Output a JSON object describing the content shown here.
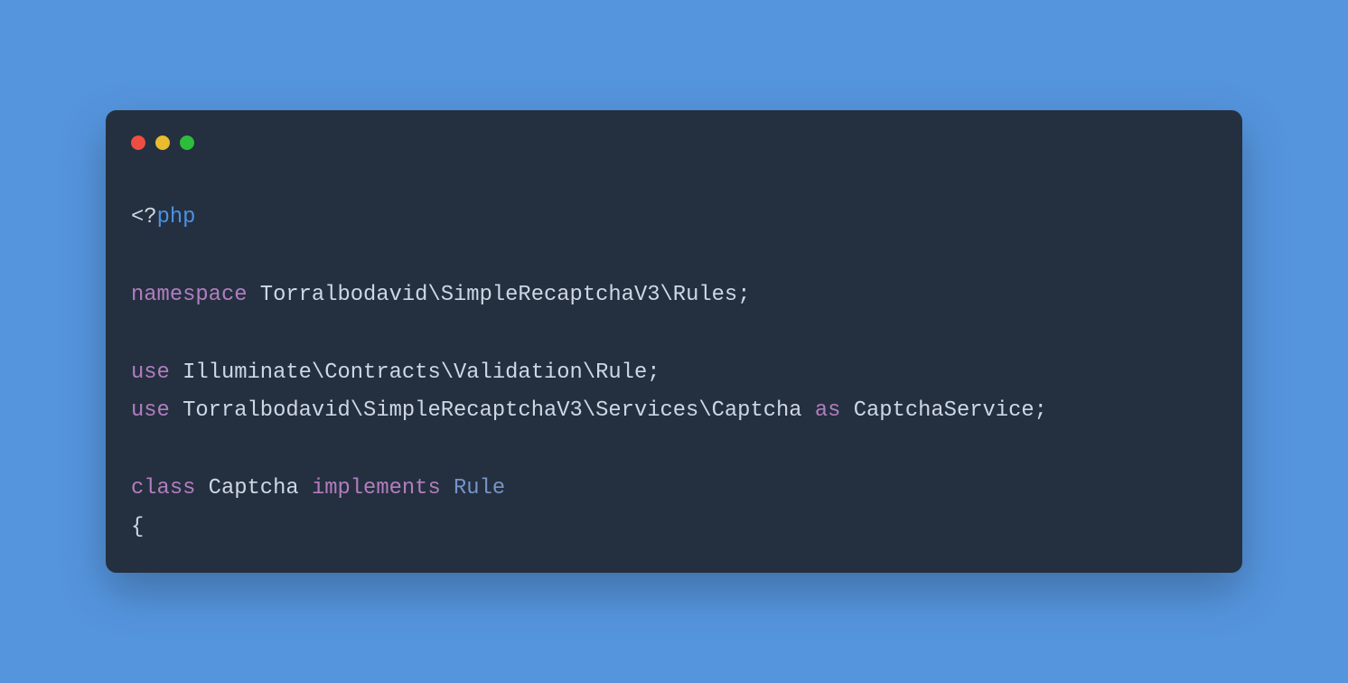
{
  "code": {
    "line1": {
      "open": "<?",
      "php": "php"
    },
    "line3": {
      "kw": "namespace",
      "ns": " Torralbodavid\\SimpleRecaptchaV3\\Rules;"
    },
    "line5": {
      "kw": "use",
      "ns": " Illuminate\\Contracts\\Validation\\Rule;"
    },
    "line6": {
      "kw": "use",
      "ns": " Torralbodavid\\SimpleRecaptchaV3\\Services\\Captcha ",
      "as": "as",
      "alias": " CaptchaService;"
    },
    "line8": {
      "kw_class": "class",
      "name": " Captcha ",
      "kw_impl": "implements",
      "sp": " ",
      "iface": "Rule"
    },
    "line9": {
      "brace": "{"
    }
  },
  "colors": {
    "bg": "#5595DE",
    "window": "#24303f",
    "dot_red": "#ee4e42",
    "dot_yellow": "#e9bb2f",
    "dot_green": "#2cbd3c",
    "text_default": "#cfd6e4",
    "text_php": "#4c91e4",
    "text_keyword": "#b27dc0",
    "text_type": "#7794c9"
  }
}
